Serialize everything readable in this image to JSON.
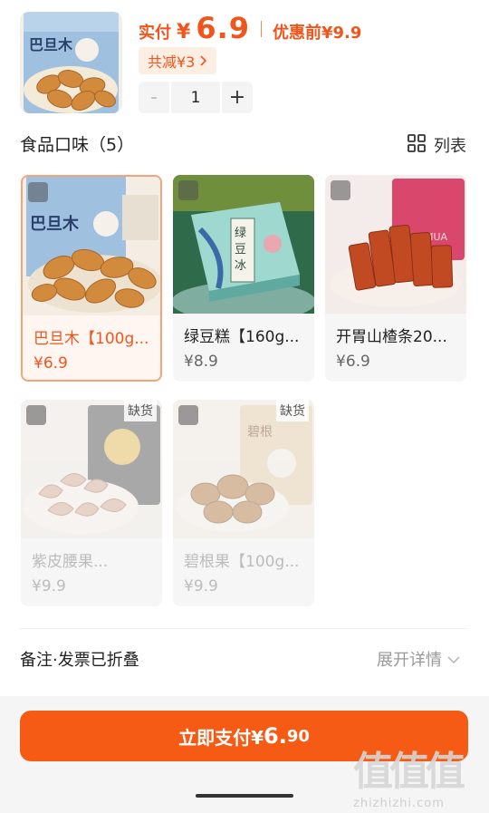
{
  "product": {
    "thumb_icon": "almond-bag-image",
    "price_label": "实付",
    "price_yen": "¥",
    "price_value": "6.9",
    "original_price": "优惠前¥9.9",
    "discount_text": "共减¥3",
    "quantity": "1",
    "minus": "-",
    "plus": "+"
  },
  "flavors": {
    "title": "食品口味（5）",
    "view_toggle": "列表",
    "items": [
      {
        "title": "巴旦木【100g...",
        "price": "¥6.9",
        "state": "selected",
        "image": "almond-image"
      },
      {
        "title": "绿豆糕【160g...",
        "price": "¥8.9",
        "state": "normal",
        "image": "mung-bean-cake-image"
      },
      {
        "title": "开胃山楂条20...",
        "price": "¥6.9",
        "state": "normal",
        "image": "hawthorn-strip-image"
      },
      {
        "title": "紫皮腰果...",
        "price": "¥9.9",
        "state": "disabled",
        "badge": "缺货",
        "image": "cashew-image"
      },
      {
        "title": "碧根果【100g...",
        "price": "¥9.9",
        "state": "disabled",
        "badge": "缺货",
        "image": "pecan-image"
      }
    ]
  },
  "note": {
    "label": "备注·发票已折叠",
    "expand": "展开详情"
  },
  "pay": {
    "label": "立即支付¥",
    "amount_int": "6.",
    "amount_dec": "90"
  },
  "watermark": {
    "big": "值值值",
    "small": "zhizhizhi.com"
  },
  "colors": {
    "accent": "#f2551c",
    "button": "#f55b14"
  }
}
